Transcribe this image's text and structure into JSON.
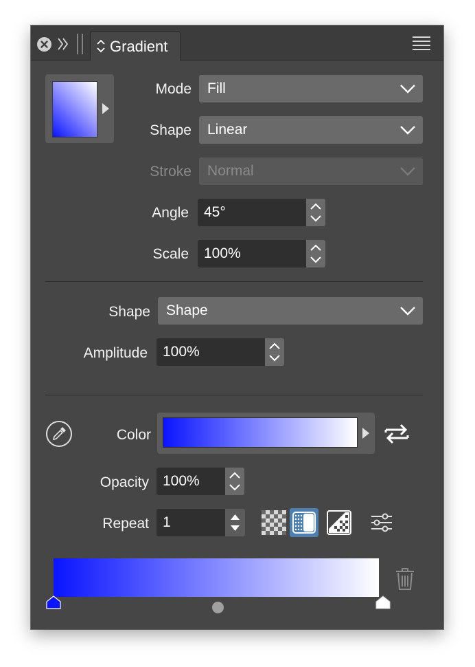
{
  "panel": {
    "tab_label": "Gradient",
    "icons": {
      "close": "close-icon",
      "expand": "double-chevron-right-icon",
      "grip": "drag-grip-icon",
      "tab_sort": "chevron-up-down-icon",
      "menu": "hamburger-menu-icon"
    }
  },
  "gradient_settings": {
    "mode": {
      "label": "Mode",
      "value": "Fill"
    },
    "shape": {
      "label": "Shape",
      "value": "Linear"
    },
    "stroke": {
      "label": "Stroke",
      "value": "Normal",
      "disabled": true
    },
    "angle": {
      "label": "Angle",
      "value": "45°"
    },
    "scale": {
      "label": "Scale",
      "value": "100%"
    }
  },
  "shape_settings": {
    "shape": {
      "label": "Shape",
      "value": "Shape"
    },
    "amplitude": {
      "label": "Amplitude",
      "value": "100%"
    }
  },
  "color_settings": {
    "color": {
      "label": "Color"
    },
    "opacity": {
      "label": "Opacity",
      "value": "100%"
    },
    "repeat": {
      "label": "Repeat",
      "value": "1"
    }
  },
  "gradient_colors": {
    "start": "#0a14ff",
    "end": "#ffffff",
    "panel_bg": "#464646",
    "active_accent": "#4d7fb0"
  }
}
